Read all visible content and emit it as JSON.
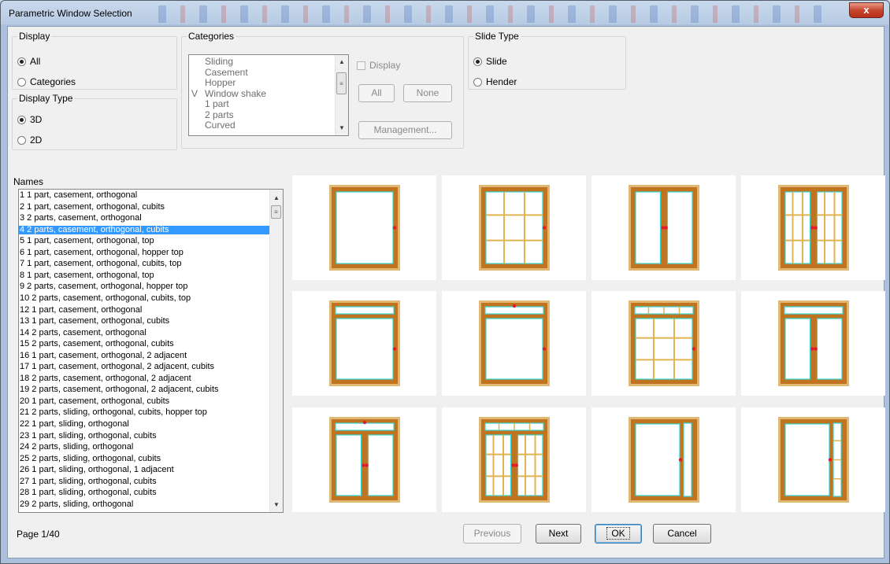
{
  "window": {
    "title": "Parametric Window Selection",
    "close_glyph": "x"
  },
  "display": {
    "legend": "Display",
    "options": [
      {
        "label": "All",
        "checked": true
      },
      {
        "label": "Categories",
        "checked": false
      }
    ]
  },
  "display_type": {
    "legend": "Display Type",
    "options": [
      {
        "label": "3D",
        "checked": true
      },
      {
        "label": "2D",
        "checked": false
      }
    ]
  },
  "categories": {
    "legend": "Categories",
    "items": [
      {
        "mark": "",
        "label": "Sliding"
      },
      {
        "mark": "",
        "label": "Casement"
      },
      {
        "mark": "",
        "label": "Hopper"
      },
      {
        "mark": "V",
        "label": "Window shake"
      },
      {
        "mark": "",
        "label": "1 part"
      },
      {
        "mark": "",
        "label": "2 parts"
      },
      {
        "mark": "",
        "label": "Curved"
      }
    ],
    "display_checkbox_label": "Display",
    "all_label": "All",
    "none_label": "None",
    "management_label": "Management..."
  },
  "slide_type": {
    "legend": "Slide Type",
    "options": [
      {
        "label": "Slide",
        "checked": true
      },
      {
        "label": "Hender",
        "checked": false
      }
    ]
  },
  "names": {
    "label": "Names",
    "selected_index": 3,
    "items": [
      "1 1 part, casement, orthogonal",
      "2 1 part, casement, orthogonal, cubits",
      "3 2 parts, casement, orthogonal",
      "4 2 parts, casement, orthogonal, cubits",
      "5 1 part, casement, orthogonal, top",
      "6 1 part, casement, orthogonal, hopper top",
      "7 1 part, casement, orthogonal, cubits, top",
      "8 1 part, casement, orthogonal, top",
      "9 2 parts, casement, orthogonal, hopper top",
      "10 2 parts, casement, orthogonal, cubits, top",
      "12 1 part, casement, orthogonal",
      "13 1 part, casement, orthogonal, cubits",
      "14 2 parts, casement, orthogonal",
      "15 2 parts, casement, orthogonal, cubits",
      "16 1 part, casement, orthogonal, 2 adjacent",
      "17 1 part, casement, orthogonal, 2 adjacent, cubits",
      "18 2 parts, casement, orthogonal, 2 adjacent",
      "19 2 parts, casement, orthogonal, 2 adjacent, cubits",
      "20 1 part, casement, orthogonal, cubits",
      "21 2 parts, sliding, orthogonal, cubits, hopper top",
      "22 1 part, sliding, orthogonal",
      "23 1 part, sliding, orthogonal, cubits",
      "24 2 parts, sliding, orthogonal",
      "25 2 parts, sliding, orthogonal, cubits",
      "26 1 part, sliding, orthogonal, 1 adjacent",
      "27 1 part, sliding, orthogonal, cubits",
      "28 1 part, sliding, orthogonal, cubits",
      "29 2 parts, sliding, orthogonal"
    ]
  },
  "previews": [
    {
      "kind": "single"
    },
    {
      "kind": "single-grid"
    },
    {
      "kind": "double"
    },
    {
      "kind": "double-grid"
    },
    {
      "kind": "single-top"
    },
    {
      "kind": "single-top-hopper"
    },
    {
      "kind": "single-top-grid"
    },
    {
      "kind": "double-top"
    },
    {
      "kind": "double-top-hopper"
    },
    {
      "kind": "double-top-grid"
    },
    {
      "kind": "single-adjacent"
    },
    {
      "kind": "single-adjacent-grid"
    }
  ],
  "colors": {
    "frame": "#c0741f",
    "frame_light": "#e0b874",
    "sash": "#c0741f",
    "glass_edge": "#35d6d6",
    "glass": "#ffffff",
    "handle": "#e8182a",
    "muntin": "#e0b450",
    "selection": "#3399ff"
  },
  "footer": {
    "page_text": "Page 1/40",
    "previous_label": "Previous",
    "next_label": "Next",
    "ok_label": "OK",
    "cancel_label": "Cancel"
  }
}
